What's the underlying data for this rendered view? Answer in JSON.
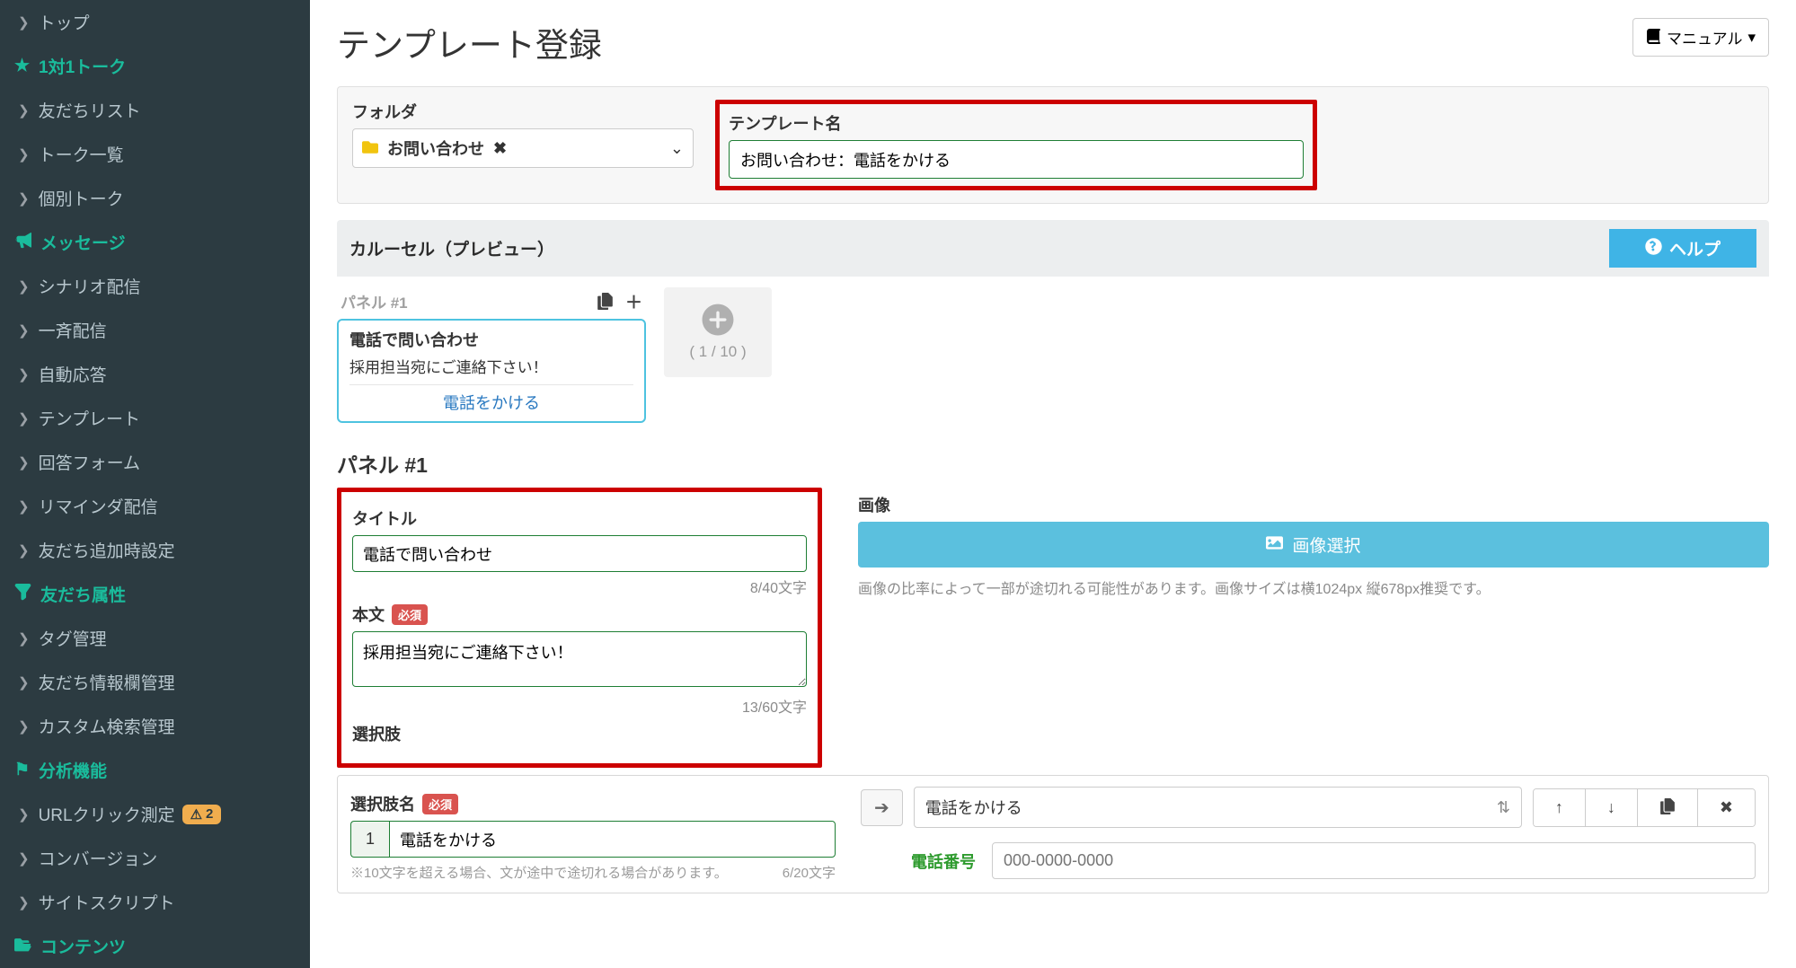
{
  "sidebar": {
    "items": [
      {
        "label": "トップ",
        "type": "item"
      },
      {
        "label": "1対1トーク",
        "type": "header",
        "icon": "star"
      },
      {
        "label": "友だちリスト",
        "type": "item"
      },
      {
        "label": "トーク一覧",
        "type": "item"
      },
      {
        "label": "個別トーク",
        "type": "item"
      },
      {
        "label": "メッセージ",
        "type": "header",
        "icon": "bullhorn"
      },
      {
        "label": "シナリオ配信",
        "type": "item"
      },
      {
        "label": "一斉配信",
        "type": "item"
      },
      {
        "label": "自動応答",
        "type": "item"
      },
      {
        "label": "テンプレート",
        "type": "item"
      },
      {
        "label": "回答フォーム",
        "type": "item"
      },
      {
        "label": "リマインダ配信",
        "type": "item"
      },
      {
        "label": "友だち追加時設定",
        "type": "item"
      },
      {
        "label": "友だち属性",
        "type": "header",
        "icon": "funnel"
      },
      {
        "label": "タグ管理",
        "type": "item"
      },
      {
        "label": "友だち情報欄管理",
        "type": "item"
      },
      {
        "label": "カスタム検索管理",
        "type": "item"
      },
      {
        "label": "分析機能",
        "type": "header",
        "icon": "flag"
      },
      {
        "label": "URLクリック測定",
        "type": "item",
        "badge": "2"
      },
      {
        "label": "コンバージョン",
        "type": "item"
      },
      {
        "label": "サイトスクリプト",
        "type": "item"
      },
      {
        "label": "コンテンツ",
        "type": "header",
        "icon": "folder"
      }
    ]
  },
  "page": {
    "title": "テンプレート登録",
    "manual_btn": "マニュアル"
  },
  "folder": {
    "label": "フォルダ",
    "selected": "お問い合わせ"
  },
  "template_name": {
    "label": "テンプレート名",
    "value": "お問い合わせ：電話をかける"
  },
  "preview": {
    "title": "カルーセル（プレビュー）",
    "help": "ヘルプ",
    "panel_label": "パネル #1",
    "card": {
      "title": "電話で問い合わせ",
      "body": "採用担当宛にご連絡下さい！",
      "action": "電話をかける"
    },
    "add_counter": "( 1 / 10 )"
  },
  "editor": {
    "heading": "パネル #1",
    "title_label": "タイトル",
    "title_value": "電話で問い合わせ",
    "title_counter": "8/40文字",
    "body_label": "本文",
    "body_value": "採用担当宛にご連絡下さい！",
    "body_counter": "13/60文字",
    "required": "必須",
    "image_label": "画像",
    "image_button": "画像選択",
    "image_note": "画像の比率によって一部が途切れる可能性があります。画像サイズは横1024px 縦678px推奨です。",
    "choice_label": "選択肢",
    "choice_name_label": "選択肢名",
    "choice_num": "1",
    "choice_value": "電話をかける",
    "choice_note": "※10文字を超える場合、文が途中で途切れる場合があります。",
    "choice_counter": "6/20文字",
    "action_select": "電話をかける",
    "phone_label": "電話番号",
    "phone_placeholder": "000-0000-0000"
  }
}
